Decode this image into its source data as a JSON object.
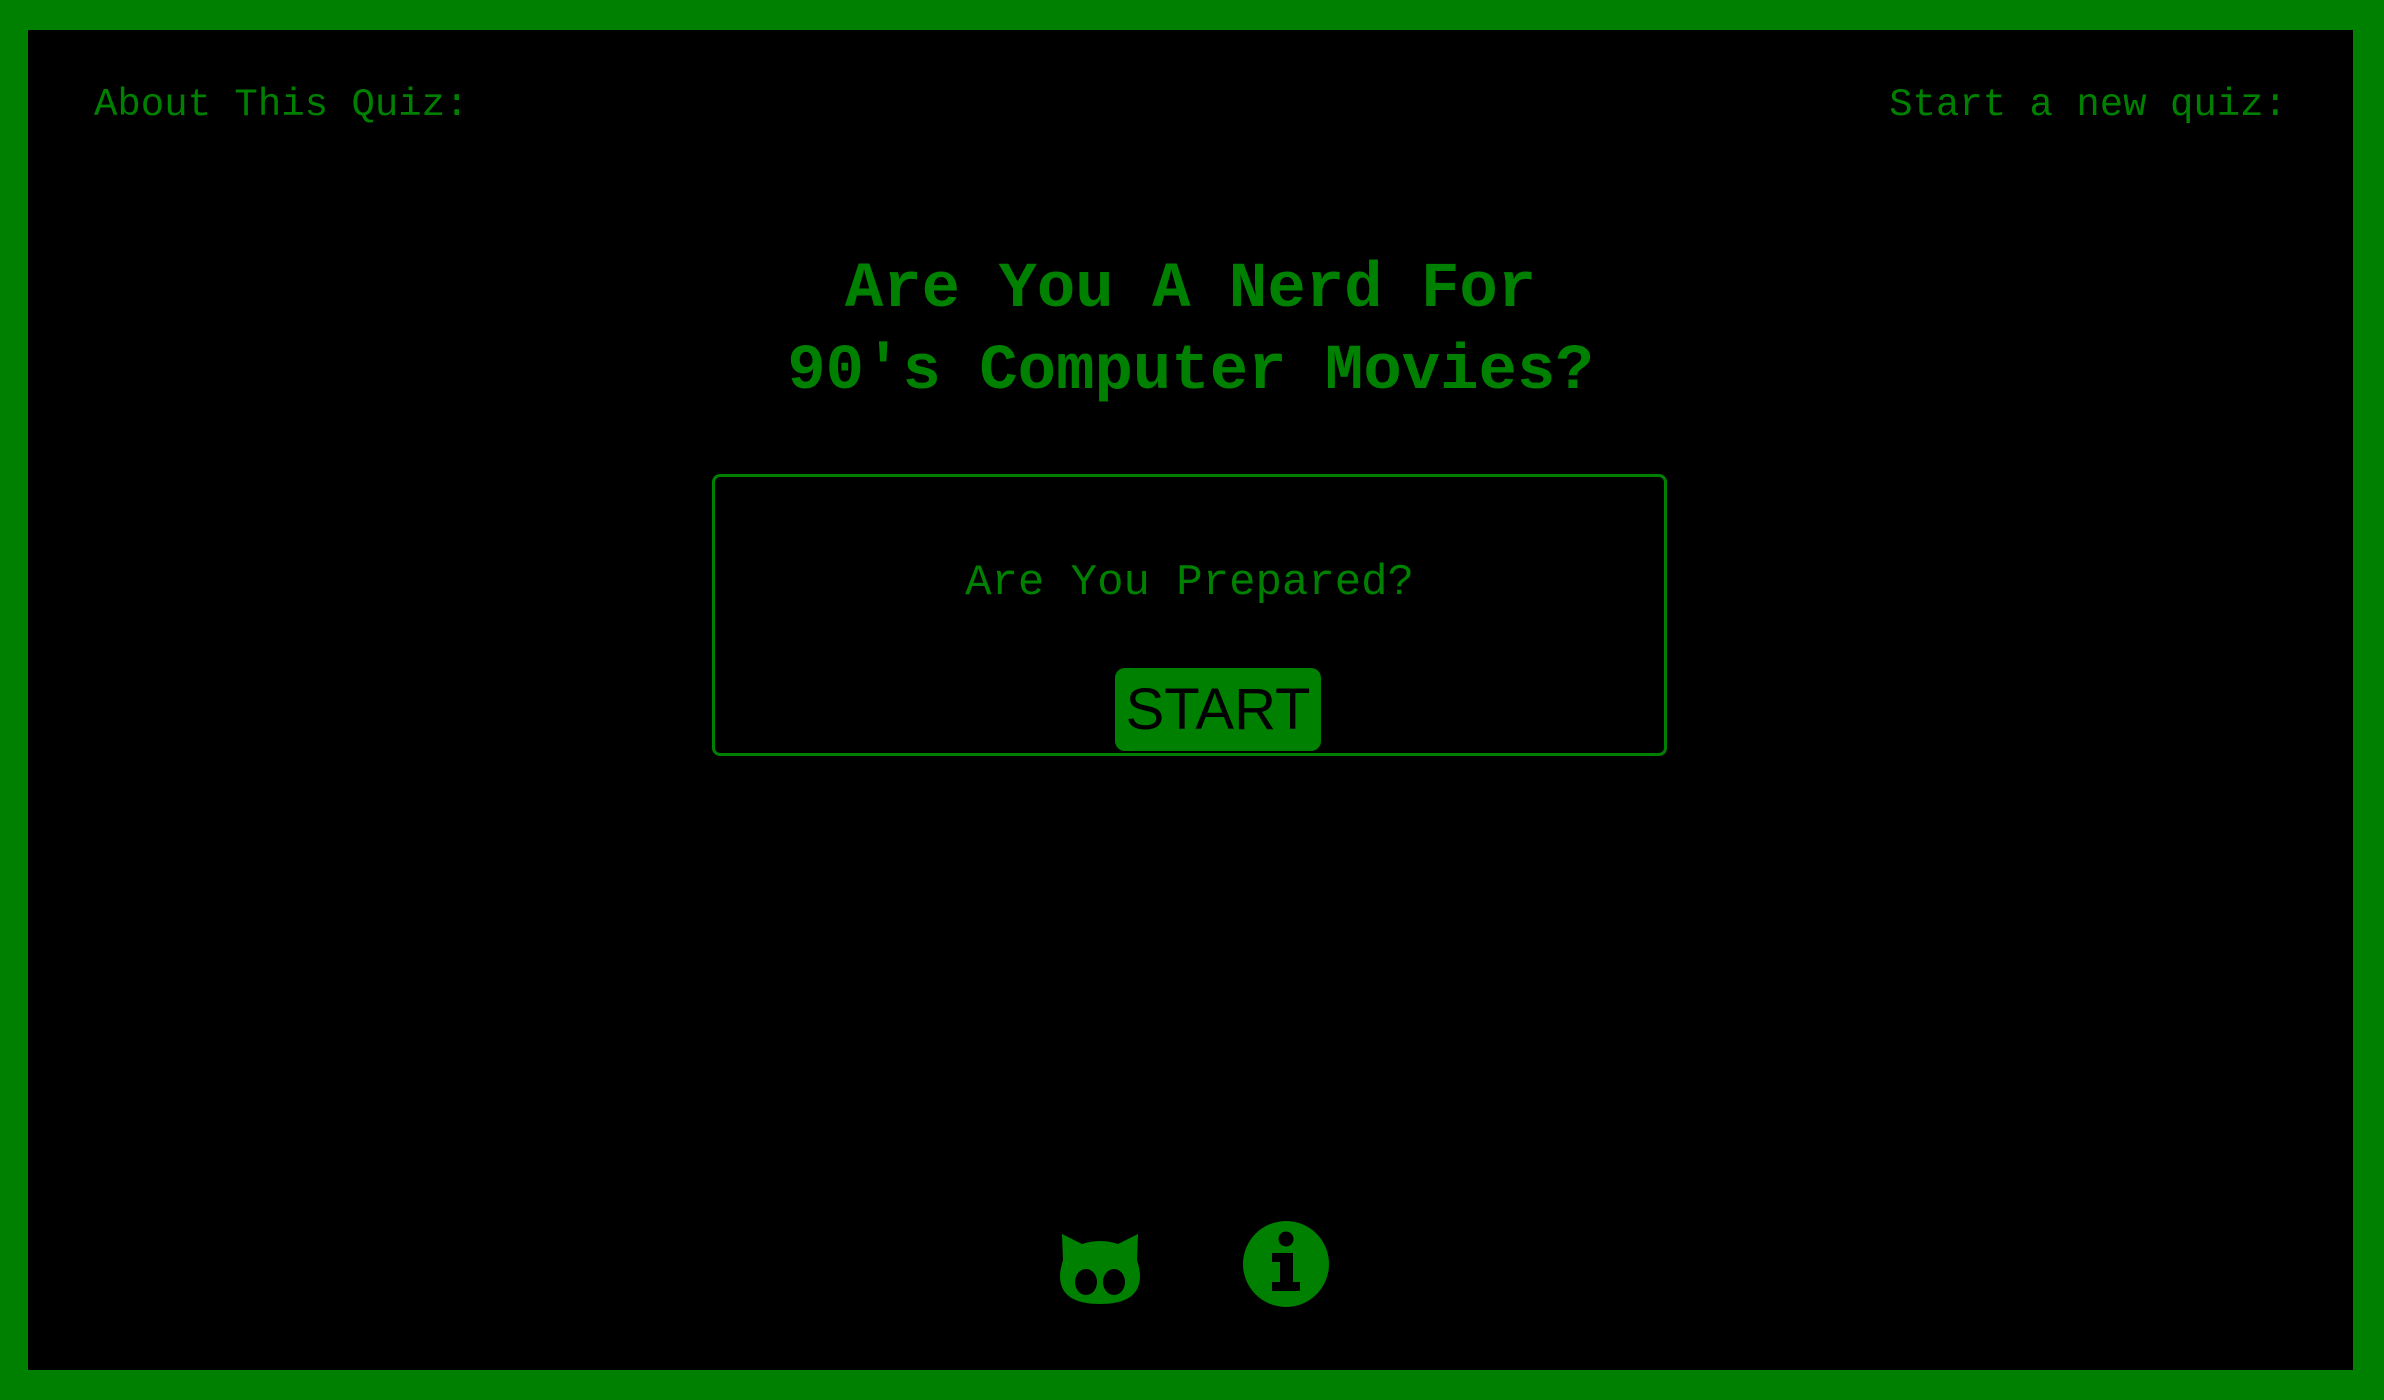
{
  "nav": {
    "about_label": "About This Quiz:",
    "new_quiz_label": "Start a new quiz:"
  },
  "title": {
    "line1": "Are You A Nerd For",
    "line2": "90's Computer Movies?"
  },
  "card": {
    "prompt": "Are You Prepared?",
    "start_label": "START"
  },
  "footer": {
    "icons": [
      "github-icon",
      "info-icon"
    ]
  },
  "colors": {
    "accent": "#008000",
    "background": "#000000"
  }
}
